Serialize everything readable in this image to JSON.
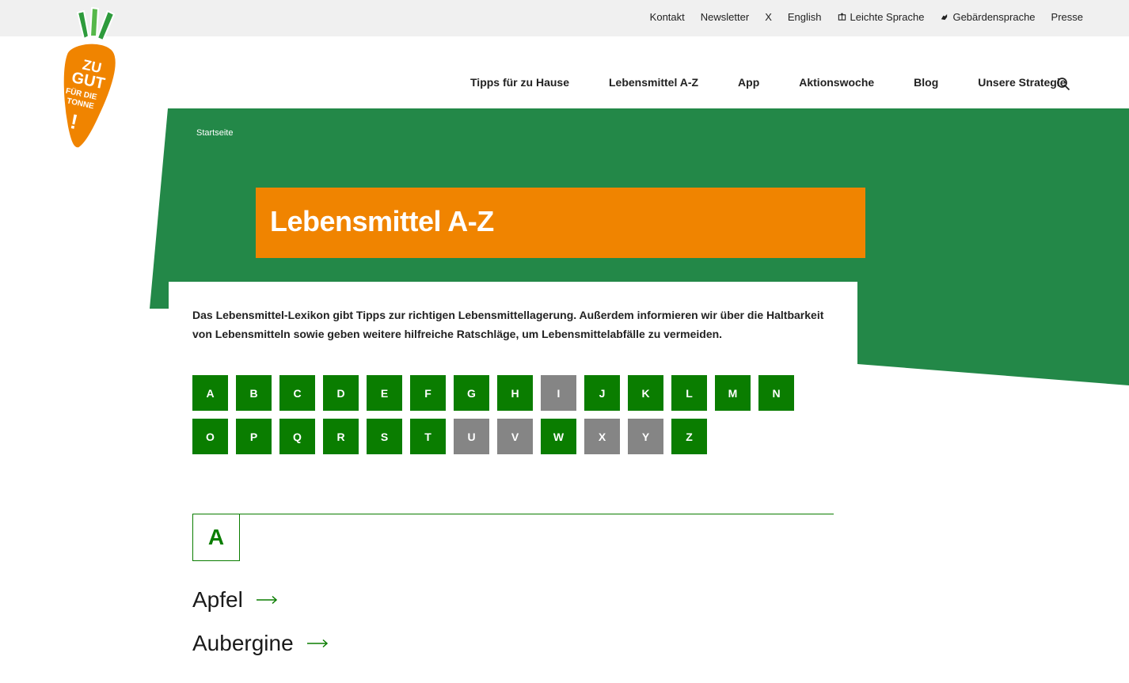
{
  "topbar": {
    "links": [
      "Kontakt",
      "Newsletter",
      "X",
      "English",
      "Leichte Sprache",
      "Gebärdensprache",
      "Presse"
    ]
  },
  "logo": {
    "lines": [
      "ZU",
      "GUT",
      "FÜR DIE",
      "TONNE",
      "!"
    ]
  },
  "nav": {
    "items": [
      "Tipps für zu Hause",
      "Lebensmittel A-Z",
      "App",
      "Aktionswoche",
      "Blog",
      "Unsere Strategie"
    ]
  },
  "breadcrumb": "Startseite",
  "page_title": "Lebensmittel A-Z",
  "intro_text": "Das Lebensmittel-Lexikon gibt Tipps zur richtigen Lebensmittellagerung. Außerdem informieren wir über die Haltbarkeit von Lebensmitteln sowie geben weitere hilfreiche Ratschläge, um Lebensmittelabfälle zu vermeiden.",
  "alphabet": [
    {
      "letter": "A",
      "enabled": true
    },
    {
      "letter": "B",
      "enabled": true
    },
    {
      "letter": "C",
      "enabled": true
    },
    {
      "letter": "D",
      "enabled": true
    },
    {
      "letter": "E",
      "enabled": true
    },
    {
      "letter": "F",
      "enabled": true
    },
    {
      "letter": "G",
      "enabled": true
    },
    {
      "letter": "H",
      "enabled": true
    },
    {
      "letter": "I",
      "enabled": false
    },
    {
      "letter": "J",
      "enabled": true
    },
    {
      "letter": "K",
      "enabled": true
    },
    {
      "letter": "L",
      "enabled": true
    },
    {
      "letter": "M",
      "enabled": true
    },
    {
      "letter": "N",
      "enabled": true
    },
    {
      "letter": "O",
      "enabled": true
    },
    {
      "letter": "P",
      "enabled": true
    },
    {
      "letter": "Q",
      "enabled": true
    },
    {
      "letter": "R",
      "enabled": true
    },
    {
      "letter": "S",
      "enabled": true
    },
    {
      "letter": "T",
      "enabled": true
    },
    {
      "letter": "U",
      "enabled": false
    },
    {
      "letter": "V",
      "enabled": false
    },
    {
      "letter": "W",
      "enabled": true
    },
    {
      "letter": "X",
      "enabled": false
    },
    {
      "letter": "Y",
      "enabled": false
    },
    {
      "letter": "Z",
      "enabled": true
    }
  ],
  "section": {
    "letter": "A",
    "entries": [
      "Apfel",
      "Aubergine"
    ]
  },
  "colors": {
    "hero_green": "#238848",
    "accent_orange": "#f08400",
    "letter_green": "#0a7d00",
    "letter_disabled": "#858585"
  }
}
